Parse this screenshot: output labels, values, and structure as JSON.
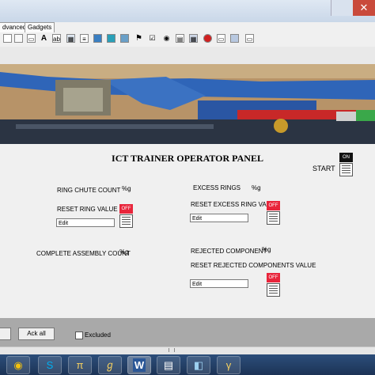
{
  "tabs": [
    {
      "label": "dvanced"
    },
    {
      "label": "Gadgets"
    }
  ],
  "toolbar_icons": [
    "page-icon",
    "doc-icon",
    "text-icon",
    "A-letter-icon",
    "input-box-icon",
    "image-icon",
    "chart-icon",
    "monitor-icon",
    "monitor2-icon",
    "grid-icon",
    "flag-icon",
    "radio-icon",
    "panel-icon",
    "table-icon",
    "record-icon",
    "slider-icon",
    "gauge-icon"
  ],
  "panel": {
    "title": "ICT TRAINER OPERATOR PANEL",
    "start_label": "START",
    "start_state": "ON",
    "ring_chute_label": "RING CHUTE COUNT",
    "ring_chute_value": "%g",
    "excess_rings_label": "EXCESS RINGS",
    "excess_rings_value": "%g",
    "reset_ring_label": "RESET RING VALUE",
    "reset_ring_edit": "Edit",
    "reset_ring_state": "OFF",
    "reset_excess_label": "RESET EXCESS RING VALUE",
    "reset_excess_edit": "Edit",
    "reset_excess_state": "OFF",
    "complete_assembly_label": "COMPLETE ASSEMBLY COUNT",
    "complete_assembly_value": "%g",
    "rejected_label": "REJECTED COMPONENT",
    "rejected_value": "%g",
    "reset_rejected_label": "RESET REJECTED COMPONENTS VALUE",
    "reset_rejected_edit": "Edit",
    "reset_rejected_state": "OFF"
  },
  "bottom": {
    "ack_all": "Ack all",
    "excluded": "Excluded"
  },
  "taskbar_icons": [
    "chrome-icon",
    "skype-icon",
    "pi-icon",
    "script-icon",
    "word-icon",
    "calculator-icon",
    "notepad-icon",
    "gamma-icon"
  ],
  "colors": {
    "off_red": "#e8253b",
    "on_black": "#111111",
    "taskbar": "#1c3356"
  }
}
